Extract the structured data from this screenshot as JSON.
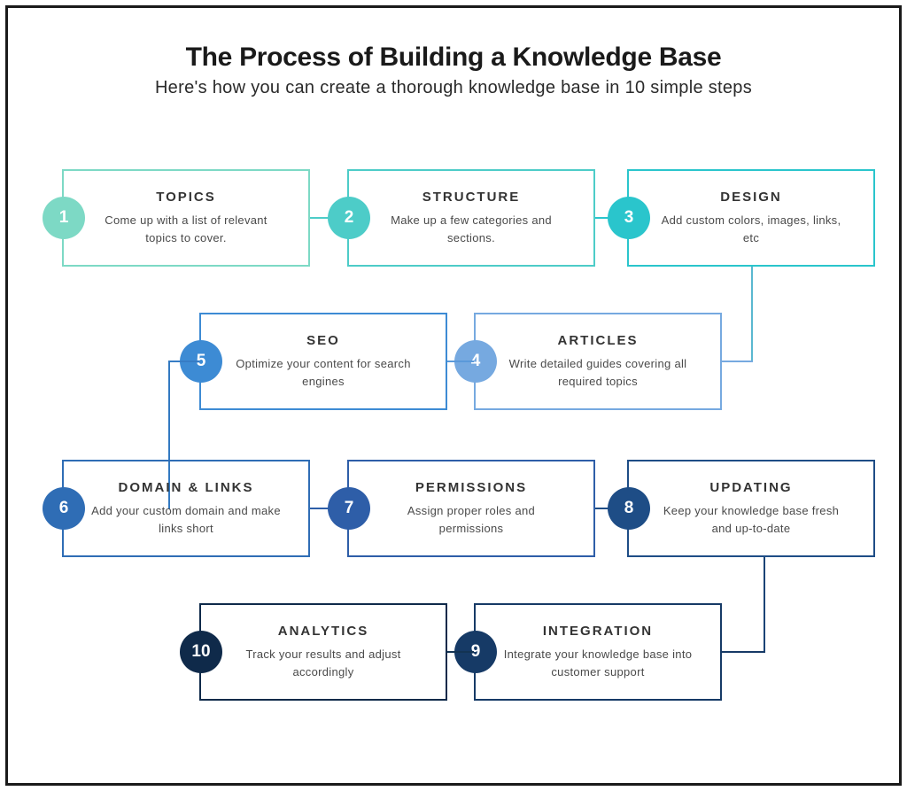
{
  "header": {
    "title": "The Process of Building a Knowledge Base",
    "subtitle": "Here's how you can create a thorough knowledge base in 10 simple steps"
  },
  "steps": {
    "s1": {
      "num": "1",
      "title": "TOPICS",
      "desc": "Come up with a list of relevant topics to cover."
    },
    "s2": {
      "num": "2",
      "title": "STRUCTURE",
      "desc": "Make up a few categories and sections."
    },
    "s3": {
      "num": "3",
      "title": "DESIGN",
      "desc": "Add custom colors, images, links, etc"
    },
    "s4": {
      "num": "4",
      "title": "ARTICLES",
      "desc": "Write detailed guides covering all required topics"
    },
    "s5": {
      "num": "5",
      "title": "SEO",
      "desc": "Optimize your content for search engines"
    },
    "s6": {
      "num": "6",
      "title": "DOMAIN & LINKS",
      "desc": "Add your custom domain and make links short"
    },
    "s7": {
      "num": "7",
      "title": "PERMISSIONS",
      "desc": "Assign proper roles and permissions"
    },
    "s8": {
      "num": "8",
      "title": "UPDATING",
      "desc": "Keep your knowledge base fresh and up-to-date"
    },
    "s9": {
      "num": "9",
      "title": "INTEGRATION",
      "desc": "Integrate your knowledge base into customer support"
    },
    "s10": {
      "num": "10",
      "title": "ANALYTICS",
      "desc": "Track your results and adjust accordingly"
    }
  },
  "colors": {
    "s1_border": "#7dd9c5",
    "s1_circle": "#7dd9c5",
    "s2_border": "#4dccc8",
    "s2_circle": "#4dccc8",
    "s3_border": "#2ac5cc",
    "s3_circle": "#2ac5cc",
    "s4_border": "#76a9e0",
    "s4_circle": "#76a9e0",
    "s5_border": "#3d8bd4",
    "s5_circle": "#3d8bd4",
    "s6_border": "#2f6db5",
    "s6_circle": "#2f6db5",
    "s7_border": "#2e5ea8",
    "s7_circle": "#2e5ea8",
    "s8_border": "#1e4d86",
    "s8_circle": "#1e4d86",
    "s9_border": "#163a66",
    "s9_circle": "#163a66",
    "s10_border": "#0f2a4a",
    "s10_circle": "#0f2a4a"
  }
}
